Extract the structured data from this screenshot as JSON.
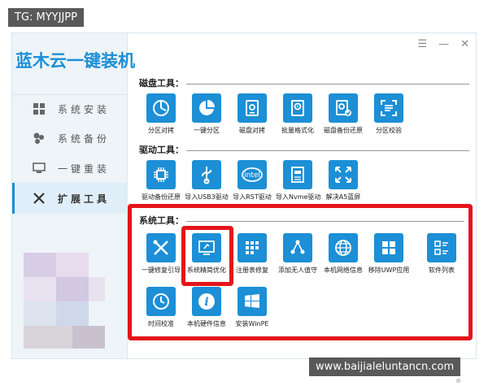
{
  "watermark_top": "TG: MYYJJPP",
  "watermark_bottom": "www.baijialeluntancn.com",
  "app": {
    "title": "蓝木云一键装机"
  },
  "window_controls": {
    "settings": "☰",
    "minimize": "—",
    "close": "✕"
  },
  "sidebar": {
    "items": [
      {
        "label": "系统安装",
        "icon": "windows-icon"
      },
      {
        "label": "系统备份",
        "icon": "backup-icon"
      },
      {
        "label": "一键重装",
        "icon": "monitor-icon"
      },
      {
        "label": "扩展工具",
        "icon": "tools-icon",
        "active": true
      }
    ]
  },
  "sections": {
    "disk": {
      "title": "磁盘工具：",
      "tools": [
        {
          "label": "分区对拷",
          "icon": "pie-clock-icon"
        },
        {
          "label": "一键分区",
          "icon": "pie-chart-icon"
        },
        {
          "label": "磁盘对拷",
          "icon": "disk-copy-icon"
        },
        {
          "label": "批量格式化",
          "icon": "disk-format-icon"
        },
        {
          "label": "磁盘备份还原",
          "icon": "disk-backup-icon"
        },
        {
          "label": "分区校验",
          "icon": "scan-icon"
        }
      ]
    },
    "driver": {
      "title": "驱动工具：",
      "tools": [
        {
          "label": "驱动备份还原",
          "icon": "chip-icon"
        },
        {
          "label": "导入USB3驱动",
          "icon": "usb-icon"
        },
        {
          "label": "导入RST驱动",
          "icon": "intel-icon"
        },
        {
          "label": "导入Nvme驱动",
          "icon": "nvme-icon"
        },
        {
          "label": "解决A5蓝屏",
          "icon": "expand-icon"
        }
      ]
    },
    "system": {
      "title": "系统工具：",
      "tools": [
        {
          "label": "一键修复引导",
          "icon": "repair-icon"
        },
        {
          "label": "系统精简优化",
          "icon": "optimize-icon"
        },
        {
          "label": "注册表修复",
          "icon": "registry-icon"
        },
        {
          "label": "添加无人值守",
          "icon": "share-icon"
        },
        {
          "label": "本机网络信息",
          "icon": "globe-icon"
        },
        {
          "label": "移除UWP应用",
          "icon": "uwp-icon"
        },
        {
          "label": "软件列表",
          "icon": "list-icon"
        },
        {
          "label": "时间校准",
          "icon": "clock-icon"
        },
        {
          "label": "本机硬件信息",
          "icon": "info-icon"
        },
        {
          "label": "安装WinPE",
          "icon": "winpe-icon"
        }
      ]
    }
  },
  "colors": {
    "accent": "#1c8fd6",
    "highlight": "#e4141b"
  }
}
